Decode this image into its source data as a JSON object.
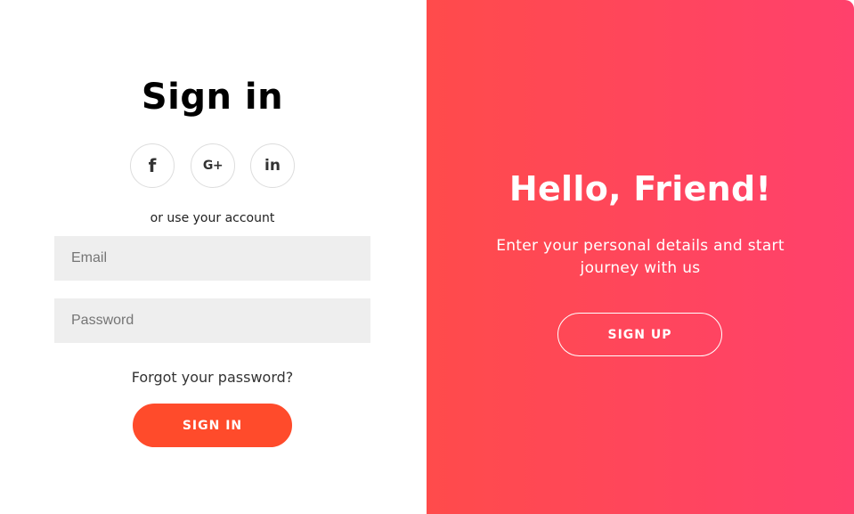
{
  "sign_in_panel": {
    "title": "Sign in",
    "social": [
      {
        "icon": "facebook-icon",
        "glyph": "f"
      },
      {
        "icon": "google-plus-icon",
        "glyph": "G+"
      },
      {
        "icon": "linkedin-icon",
        "glyph": "in"
      }
    ],
    "alt_text": "or use your account",
    "email": {
      "value": "",
      "placeholder": "Email"
    },
    "password": {
      "value": "",
      "placeholder": "Password"
    },
    "forgot_link": "Forgot your password?",
    "submit_label": "SIGN IN"
  },
  "overlay_panel": {
    "title": "Hello, Friend!",
    "description": "Enter your personal details and start journey with us",
    "signup_label": "SIGN UP"
  },
  "colors": {
    "accent": "#ff4b2b",
    "gradient_start": "#ff4b4b",
    "gradient_end": "#ff416c",
    "input_bg": "#eeeeee"
  }
}
